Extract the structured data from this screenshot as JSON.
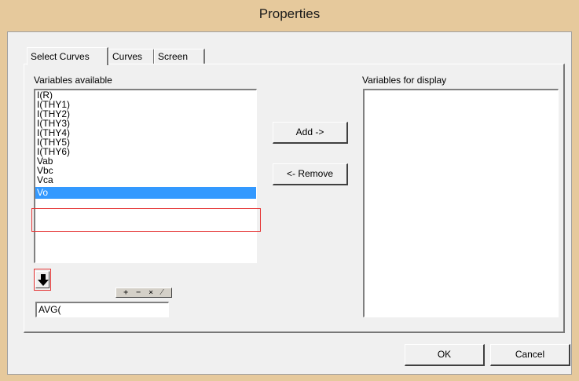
{
  "window": {
    "title": "Properties"
  },
  "tabs": [
    {
      "label": "Select Curves",
      "active": true
    },
    {
      "label": "Curves",
      "active": false
    },
    {
      "label": "Screen",
      "active": false
    }
  ],
  "available": {
    "label": "Variables available",
    "items": [
      "I(R)",
      "I(THY1)",
      "I(THY2)",
      "I(THY3)",
      "I(THY4)",
      "I(THY5)",
      "I(THY6)",
      "Vab",
      "Vbc",
      "Vca",
      "Vo"
    ],
    "selected": "Vo"
  },
  "display": {
    "label": "Variables for display"
  },
  "buttons": {
    "add": "Add ->",
    "remove": "<- Remove",
    "ok": "OK",
    "cancel": "Cancel"
  },
  "expression": {
    "operators": "+ − × ⁄ ...",
    "value": "AVG("
  },
  "icons": {
    "down_arrow": "arrow-down-icon"
  },
  "colors": {
    "selection": "#3399ff",
    "highlight_box": "#e53535",
    "titlebar": "#e6c99c"
  }
}
